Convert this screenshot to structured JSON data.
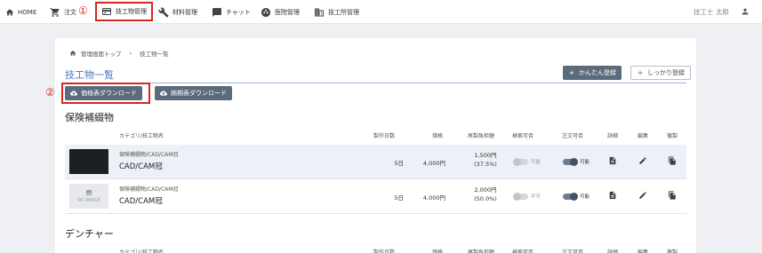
{
  "nav": {
    "home": "HOME",
    "order": "注文",
    "products": "技工物管理",
    "materials": "材料管理",
    "chat": "チャット",
    "clinics": "医院管理",
    "labs": "技工所管理",
    "user": "技工士 太郎"
  },
  "annotations": {
    "first": "①",
    "second": "②"
  },
  "breadcrumb": {
    "top": "管理画面トップ",
    "current": "技工物一覧"
  },
  "page": {
    "title": "技工物一覧",
    "quick_register": "かんたん登録",
    "full_register": "しっかり登録",
    "price_download": "価格表ダウンロード",
    "delivery_download": "納期表ダウンロード"
  },
  "columns": {
    "category_name": "カテゴリ/技工物名",
    "days": "製作日数",
    "price": "価格",
    "reorder": "再製負担額",
    "inspect": "検索可否",
    "order": "注文可否",
    "detail": "詳細",
    "edit": "編集",
    "copy": "複製"
  },
  "sections": [
    {
      "title": "保険補綴物",
      "rows": [
        {
          "thumb": "photo",
          "category": "保険補綴物/CAD/CAM冠",
          "name": "CAD/CAM冠",
          "days": "5日",
          "price": "4,000円",
          "reorder_amount": "1,500円",
          "reorder_rate": "(37.5%)",
          "inspect": {
            "on": false,
            "label": "可能"
          },
          "order": {
            "on": true,
            "label": "可能"
          }
        },
        {
          "thumb": "noimage",
          "noimage_label": "NO IMAGE",
          "category": "保険補綴物/CAD/CAM冠",
          "name": "CAD/CAM冠",
          "days": "5日",
          "price": "4,000円",
          "reorder_amount": "2,000円",
          "reorder_rate": "(50.0%)",
          "inspect": {
            "on": false,
            "label": "不可"
          },
          "order": {
            "on": true,
            "label": "可能"
          }
        }
      ]
    },
    {
      "title": "デンチャー",
      "rows": []
    }
  ]
}
